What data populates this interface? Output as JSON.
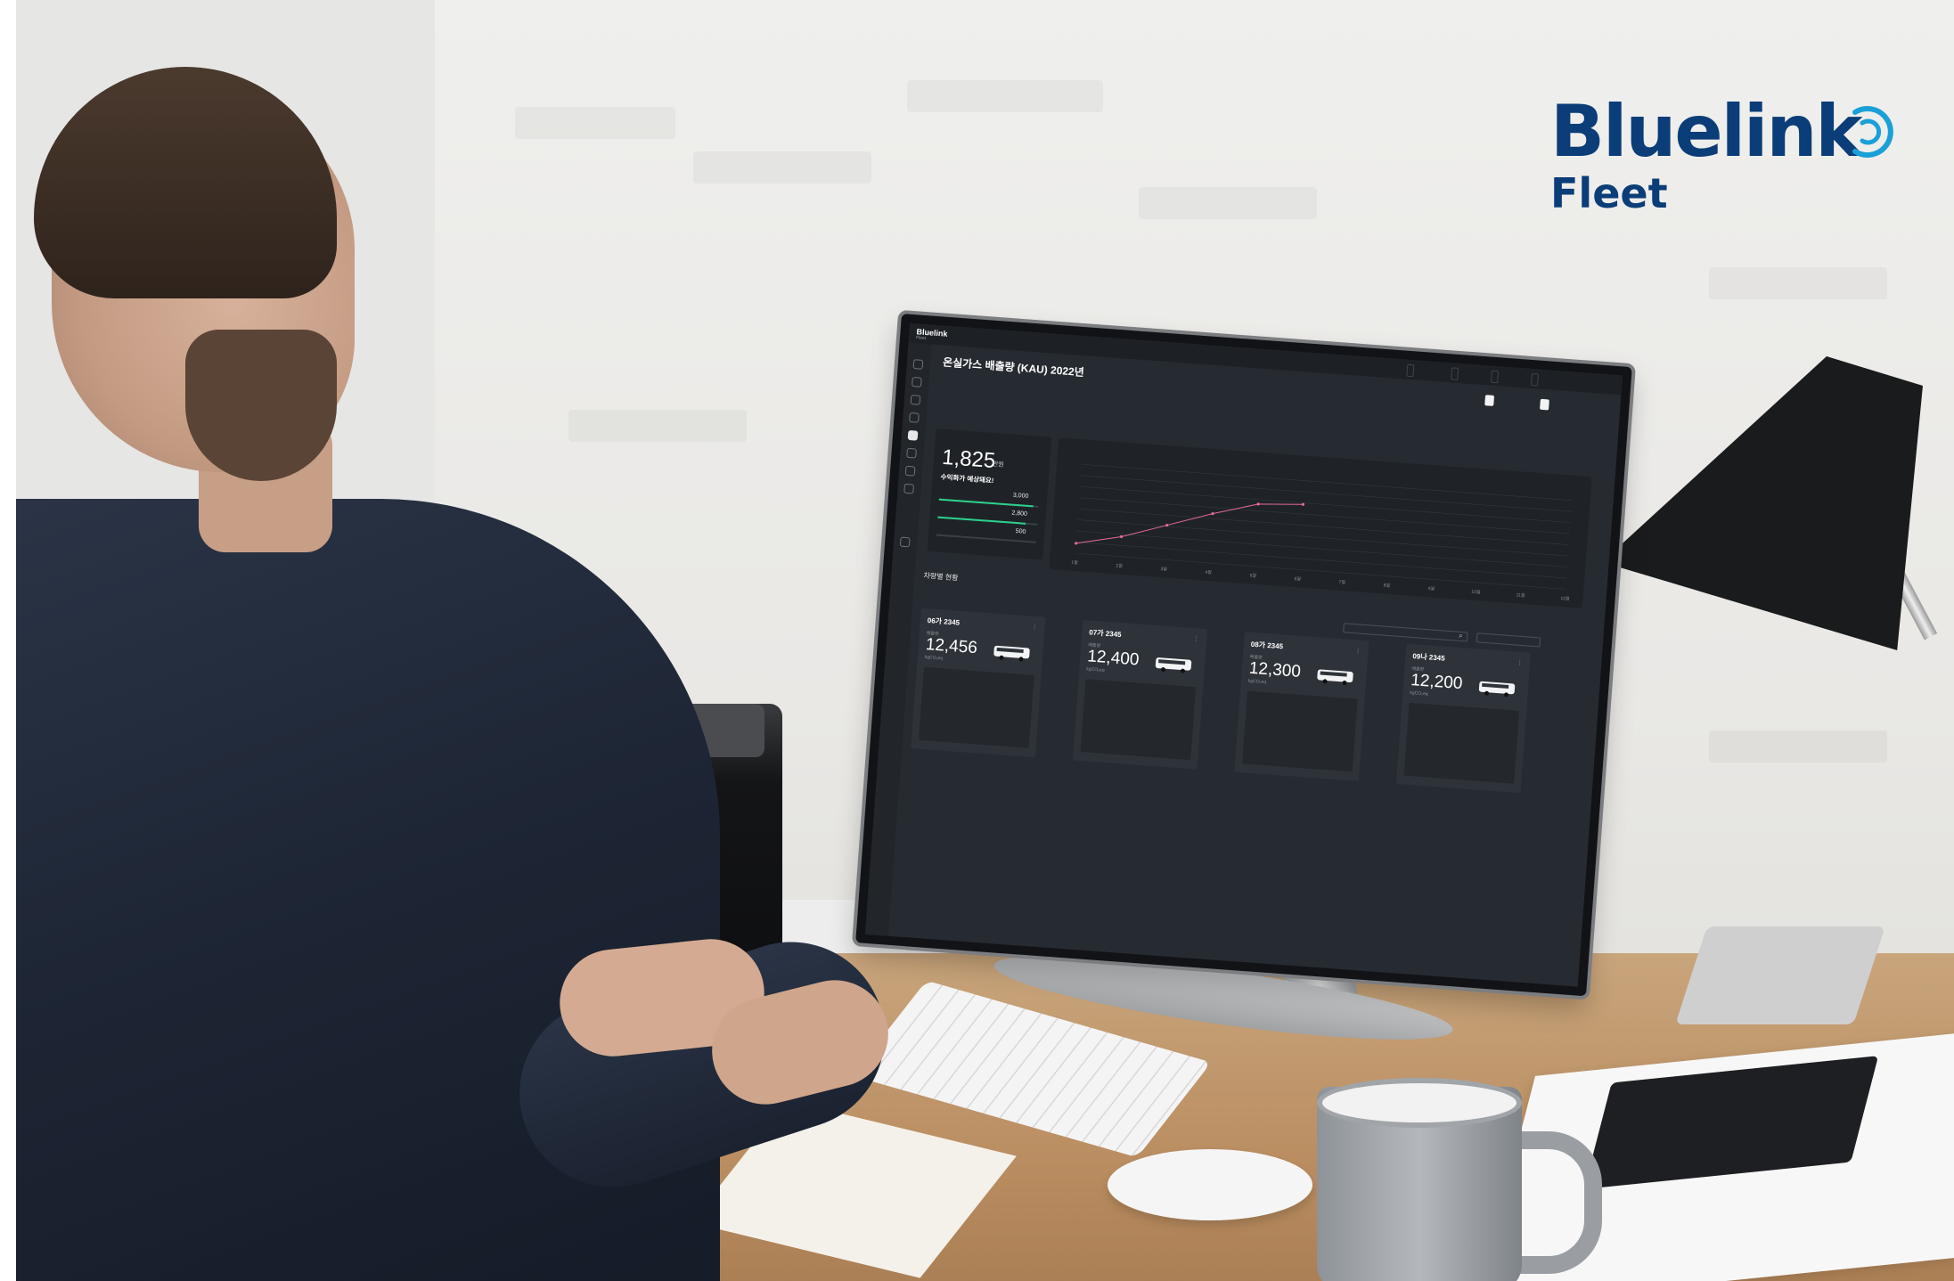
{
  "brand": {
    "logo_text": "Bluelink",
    "logo_sub": "Fleet",
    "color": "#0b3d78",
    "ring_color": "#1aa0d8"
  },
  "app": {
    "name": "Bluelink",
    "name_sub": "Fleet",
    "page_title": "온실가스 배출량 (KAU) 2022년",
    "date_range": "",
    "header_buttons": [
      "",
      ""
    ],
    "topbar_buttons": [
      "",
      "",
      "",
      "",
      ""
    ],
    "description": [
      "",
      "",
      "",
      ""
    ]
  },
  "kau_summary": {
    "label": "",
    "value": "1,825",
    "unit": "만원",
    "status": "수익화가 예상돼요!",
    "rows": [
      {
        "label": "",
        "value": "3,000",
        "unit": "",
        "fraction": 0.95,
        "color": "#2bd18a"
      },
      {
        "label": "",
        "value": "2,800",
        "unit": "",
        "fraction": 0.88,
        "color": "#2bd18a"
      },
      {
        "label": "",
        "value": "500",
        "unit": "",
        "fraction": 0.18,
        "color": "#3a3f46"
      }
    ],
    "note": ""
  },
  "chart_data": {
    "type": "line",
    "title": "",
    "legend": "",
    "categories": [
      "1월",
      "2월",
      "3월",
      "4월",
      "5월",
      "6월",
      "7월",
      "8월",
      "9월",
      "10월",
      "11월",
      "12월"
    ],
    "series": [
      {
        "values": [
          1,
          2,
          3.5,
          5,
          6.3,
          6.6,
          null,
          null,
          null,
          null,
          null,
          null
        ],
        "color": "#e36a9e"
      }
    ],
    "y_ticks": [
      "",
      "",
      "",
      "",
      "",
      "",
      "",
      "",
      ""
    ],
    "ylim": [
      0,
      9
    ],
    "grid": true
  },
  "fleet": {
    "title": "차량별 현황",
    "search_placeholder": "",
    "sort_label": "",
    "vehicles": [
      {
        "plate": "06가 2345",
        "plate_sub": "",
        "label": "배출량",
        "value": "12,456",
        "unit": "kgCO₂eq",
        "p1l": "",
        "p1v": "",
        "p2l": "",
        "p2v": ""
      },
      {
        "plate": "07가 2345",
        "plate_sub": "",
        "label": "배출량",
        "value": "12,400",
        "unit": "kgCO₂eq",
        "p1l": "",
        "p1v": "",
        "p2l": "",
        "p2v": ""
      },
      {
        "plate": "08가 2345",
        "plate_sub": "",
        "label": "배출량",
        "value": "12,300",
        "unit": "kgCO₂eq",
        "p1l": "",
        "p1v": "",
        "p2l": "",
        "p2v": ""
      },
      {
        "plate": "09나 2345",
        "plate_sub": "",
        "label": "배출량",
        "value": "12,200",
        "unit": "kgCO₂eq",
        "p1l": "",
        "p1v": "",
        "p2l": "",
        "p2v": ""
      }
    ]
  },
  "sidebar_icons": [
    "grid-icon",
    "box-icon",
    "car-icon",
    "gauge-icon",
    "leaf-icon",
    "doc-icon",
    "map-icon",
    "clock-icon",
    "settings-icon"
  ]
}
